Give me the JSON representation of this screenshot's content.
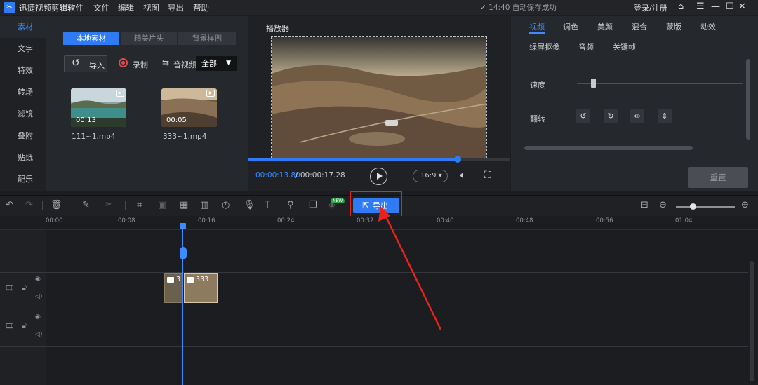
{
  "app": {
    "title": "迅捷视频剪辑软件",
    "menu": [
      "文件",
      "编辑",
      "视图",
      "导出",
      "帮助"
    ],
    "autosave": "14:40 自动保存成功",
    "login": "登录/注册"
  },
  "leftnav": [
    "素材",
    "文字",
    "特效",
    "转场",
    "滤镜",
    "叠附",
    "贴纸",
    "配乐"
  ],
  "material": {
    "tabs": [
      "本地素材",
      "精美片头",
      "背景样例"
    ],
    "import_label": "导入",
    "record_label": "录制",
    "av_label": "音视频",
    "filter_value": "全部",
    "items": [
      {
        "name": "111~1.mp4",
        "duration": "00:13"
      },
      {
        "name": "333~1.mp4",
        "duration": "00:05"
      }
    ]
  },
  "player": {
    "title": "播放器",
    "current_time": "00:00:13.80",
    "total_time": "/ 00:00:17.28",
    "progress": 0.8,
    "ratio": "16:9"
  },
  "props": {
    "tabs_row1": [
      "视频",
      "调色",
      "美颜",
      "混合",
      "蒙版",
      "动效"
    ],
    "tabs_row2": [
      "绿屏抠像",
      "音频",
      "关键帧"
    ],
    "speed_label": "速度",
    "flip_label": "翻转",
    "reset_label": "重置"
  },
  "toolbar": {
    "export_label": "导出",
    "new_badge": "NEW"
  },
  "ruler": [
    "00:00",
    "00:08",
    "00:16",
    "00:24",
    "00:32",
    "00:40",
    "00:48",
    "00:56",
    "01:04"
  ],
  "clips": [
    {
      "label": "3"
    },
    {
      "label": "333"
    }
  ],
  "colors": {
    "accent": "#2f7bf5",
    "highlight": "#e8231e"
  }
}
